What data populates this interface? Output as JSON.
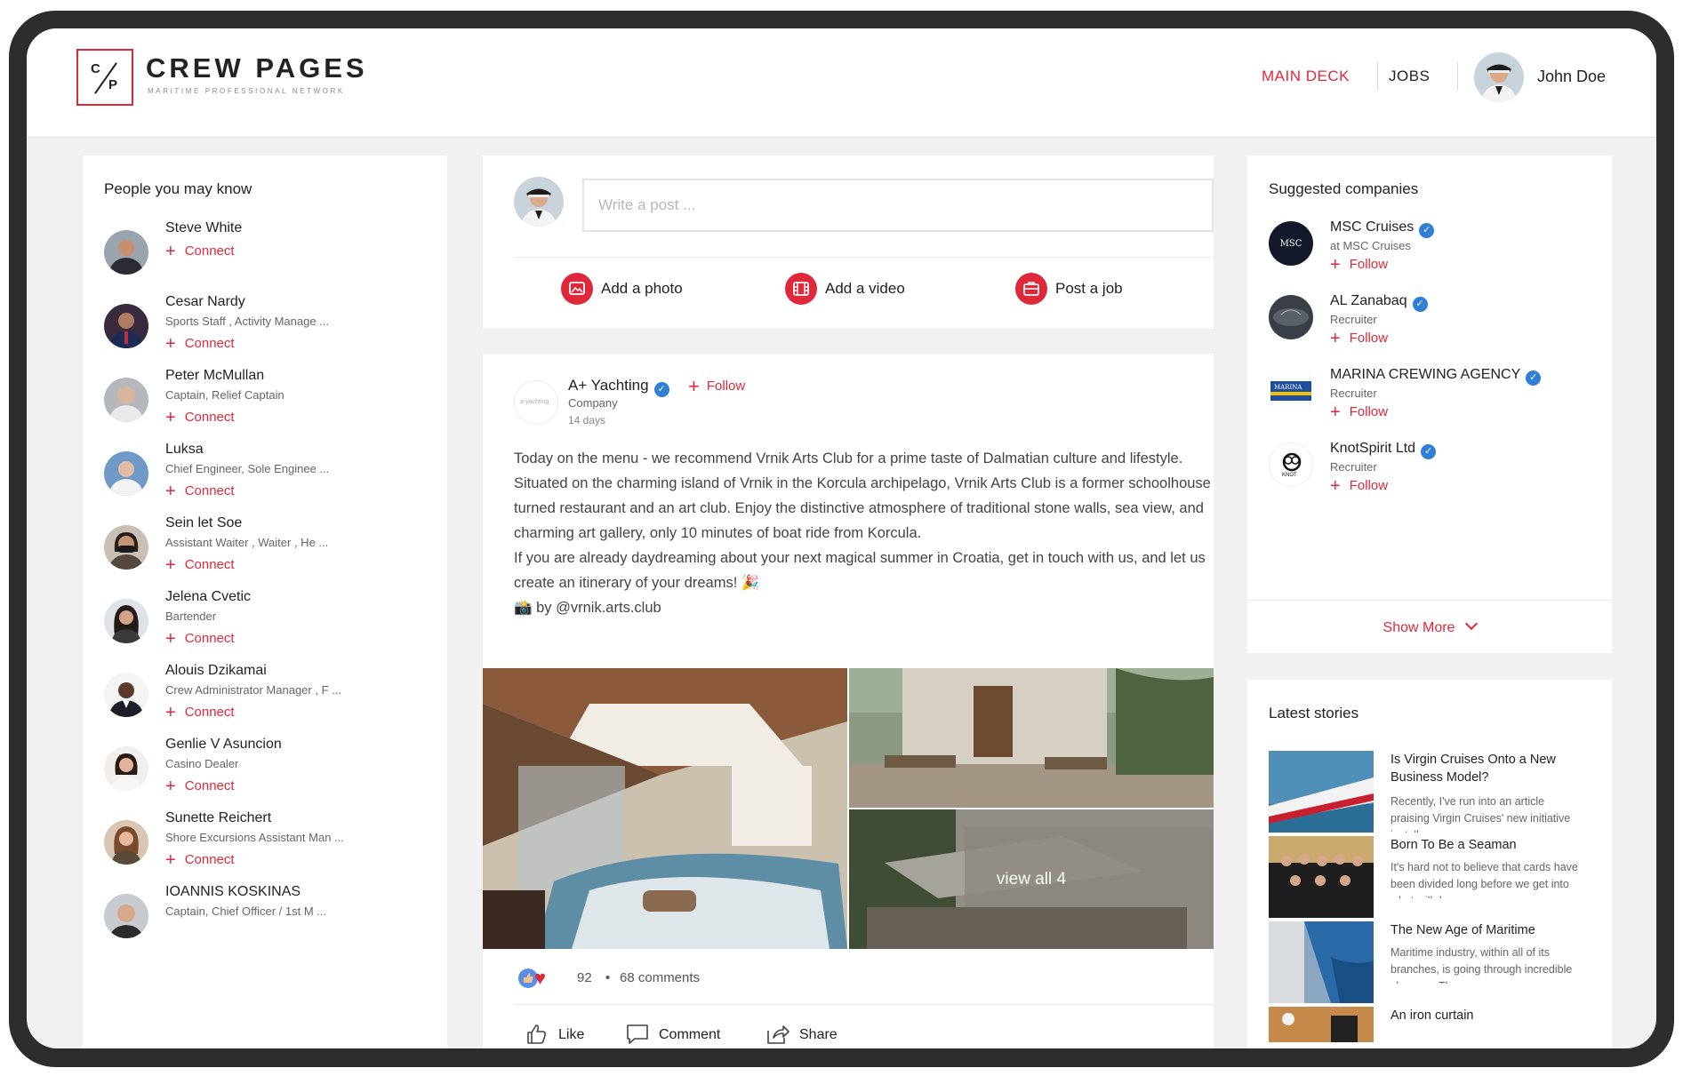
{
  "brand": {
    "initial_top": "C",
    "initial_bottom": "P",
    "name": "CREW PAGES",
    "tagline": "MARITIME PROFESSIONAL NETWORK"
  },
  "nav": {
    "main_deck": "MAIN DECK",
    "jobs": "JOBS",
    "user_name": "John Doe"
  },
  "colors": {
    "accent": "#e0283b",
    "verified": "#2f7fd6",
    "background": "#f1f1f1",
    "frame": "#2d2d2d"
  },
  "people": {
    "title": "People you may know",
    "connect_label": "Connect",
    "items": [
      {
        "name": "Steve White",
        "role": ""
      },
      {
        "name": "Cesar Nardy",
        "role": "Sports Staff , Activity Manage ..."
      },
      {
        "name": "Peter McMullan",
        "role": "Captain, Relief Captain"
      },
      {
        "name": "Luksa",
        "role": "Chief Engineer, Sole Enginee ..."
      },
      {
        "name": "Sein let Soe",
        "role": "Assistant Waiter , Waiter , He ..."
      },
      {
        "name": "Jelena Cvetic",
        "role": "Bartender"
      },
      {
        "name": "Alouis Dzikamai",
        "role": "Crew Administrator Manager , F ..."
      },
      {
        "name": "Genlie V Asuncion",
        "role": "Casino Dealer"
      },
      {
        "name": "Sunette Reichert",
        "role": "Shore Excursions Assistant Man ..."
      },
      {
        "name": "IOANNIS KOSKINAS",
        "role": "Captain, Chief Officer / 1st M ..."
      }
    ]
  },
  "composer": {
    "placeholder": "Write a post ...",
    "actions": [
      "Add a photo",
      "Add a video",
      "Post a job"
    ]
  },
  "post": {
    "logo_text": "a-yachting",
    "company": "A+ Yachting",
    "follow_label": "Follow",
    "type": "Company",
    "time": "14 days",
    "paragraph1": "Today on the menu - we recommend Vrnik Arts Club for a prime taste of Dalmatian culture and lifestyle. Situated on the charming island of Vrnik in the Korcula archipelago, Vrnik Arts Club is a former schoolhouse turned restaurant and an art club. Enjoy the distinctive atmosphere of traditional stone walls, sea view, and charming art gallery, only 10 minutes of boat ride from Korcula.",
    "paragraph2": "If you are already daydreaming about your next magical summer in Croatia, get in touch with us, and let us create an itinerary of your dreams! 🎉",
    "paragraph3": "📸 by @vrnik.arts.club",
    "view_all": "view all 4",
    "reactions": "92",
    "separator": "•",
    "comments": "68 comments",
    "like_label": "Like",
    "comment_label": "Comment",
    "share_label": "Share"
  },
  "companies": {
    "title": "Suggested companies",
    "follow_label": "Follow",
    "show_more": "Show More",
    "items": [
      {
        "name": "MSC Cruises",
        "sub": "at MSC Cruises",
        "logo_text": "MSC"
      },
      {
        "name": "AL Zanabaq",
        "sub": "Recruiter",
        "logo_text": ""
      },
      {
        "name": "MARINA CREWING AGENCY",
        "sub": "Recruiter",
        "logo_text": "MARINA"
      },
      {
        "name": "KnotSpirit Ltd",
        "sub": "Recruiter",
        "logo_text": "KNOT"
      }
    ]
  },
  "stories": {
    "title": "Latest stories",
    "items": [
      {
        "title": "Is Virgin Cruises Onto a New Business Model?",
        "excerpt": "Recently, I've run into an article praising Virgin Cruises' new initiative installmen"
      },
      {
        "title": "Born To Be a Seaman",
        "excerpt": "It's hard not to believe that cards have been divided long before we get into what will de"
      },
      {
        "title": "The New Age of Maritime",
        "excerpt": "Maritime industry, within all of its branches, is going through incredible changes. The e"
      },
      {
        "title": "An iron curtain",
        "excerpt": ""
      }
    ]
  }
}
